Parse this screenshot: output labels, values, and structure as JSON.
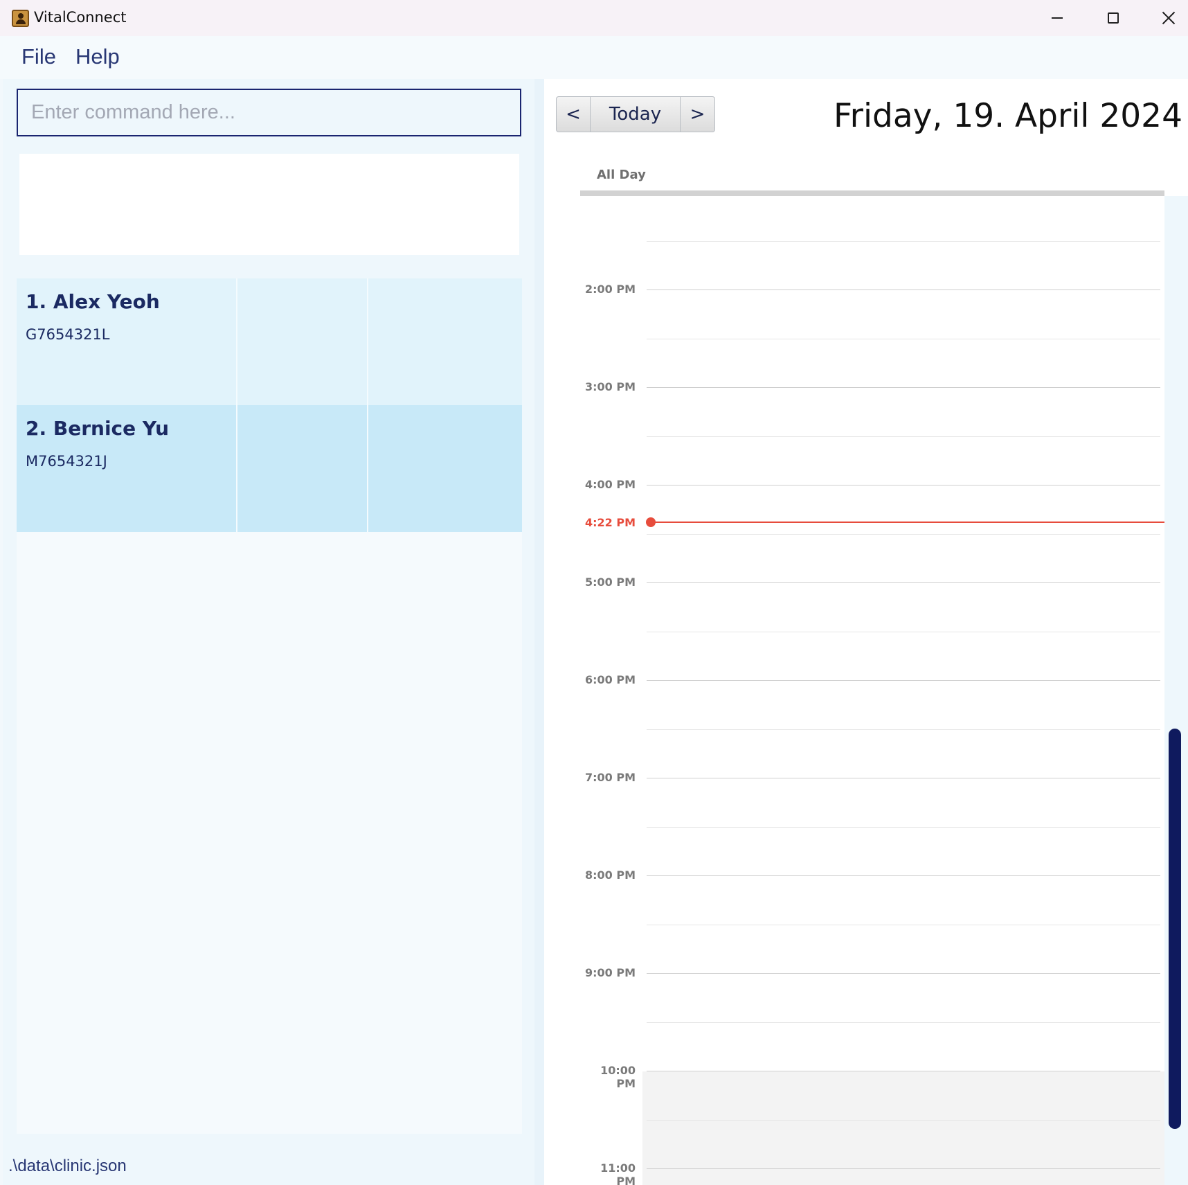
{
  "window": {
    "title": "VitalConnect"
  },
  "menu": {
    "file": "File",
    "help": "Help"
  },
  "command": {
    "placeholder": "Enter command here...",
    "value": ""
  },
  "persons": [
    {
      "name": "1. Alex Yeoh",
      "id": "G7654321L"
    },
    {
      "name": "2. Bernice Yu",
      "id": "M7654321J"
    }
  ],
  "status": {
    "path": ".\\data\\clinic.json"
  },
  "calendar": {
    "prev": "<",
    "today": "Today",
    "next": ">",
    "date": "Friday, 19. April 2024",
    "all_day": "All Day",
    "now_label": "4:22 PM",
    "hours": [
      "2:00 PM",
      "3:00 PM",
      "4:00 PM",
      "5:00 PM",
      "6:00 PM",
      "7:00 PM",
      "8:00 PM",
      "9:00 PM",
      "10:00 PM",
      "11:00 PM"
    ]
  },
  "colors": {
    "accent": "#1a2570",
    "now_indicator": "#e74c3c",
    "card_1": "#e1f3fb",
    "card_2": "#c8e9f8",
    "scroll_thumb": "#0f1a5e"
  }
}
